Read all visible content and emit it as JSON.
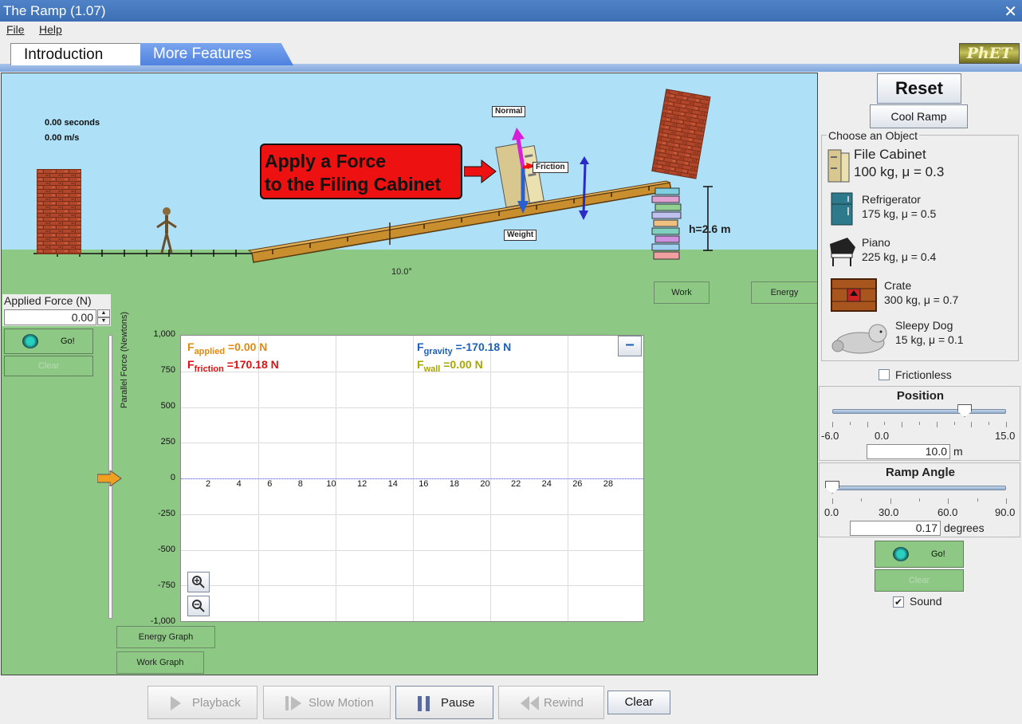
{
  "window": {
    "title": "The Ramp (1.07)",
    "close": "✕"
  },
  "menu": {
    "file": "File",
    "help": "Help"
  },
  "tabs": {
    "intro": "Introduction",
    "more": "More Features",
    "logo": "PhET"
  },
  "scene": {
    "time": "0.00 seconds",
    "speed": "0.00 m/s",
    "callout_line1": "Apply a Force",
    "callout_line2": "to the Filing Cabinet",
    "normal": "Normal",
    "friction": "Friction",
    "weight": "Weight",
    "height": "h=2.6 m",
    "angle": "10.0°",
    "work_btn": "Work",
    "energy_btn": "Energy"
  },
  "applied": {
    "label": "Applied Force (N)",
    "value": "0.00",
    "go": "Go!",
    "clear": "Clear"
  },
  "graph": {
    "ylabel": "Parallel Force (Newtons)",
    "yticks": [
      "1,000",
      "750",
      "500",
      "250",
      "0",
      "-250",
      "-500",
      "-750",
      "-1,000"
    ],
    "xticks": [
      "2",
      "4",
      "6",
      "8",
      "10",
      "12",
      "14",
      "16",
      "18",
      "20",
      "22",
      "24",
      "26",
      "28"
    ],
    "f_applied_main": "F",
    "f_applied_sub": "applied",
    "f_applied_val": " =0.00 N",
    "f_friction_main": "F",
    "f_friction_sub": "friction",
    "f_friction_val": " =170.18 N",
    "f_gravity_main": "F",
    "f_gravity_sub": "gravity",
    "f_gravity_val": " =-170.18 N",
    "f_wall_main": "F",
    "f_wall_sub": "wall",
    "f_wall_val": " =0.00 N",
    "minimize": "–",
    "energy_graph": "Energy Graph",
    "work_graph": "Work Graph"
  },
  "right": {
    "reset": "Reset",
    "cool_ramp": "Cool Ramp",
    "choose": "Choose an Object",
    "objects": [
      {
        "name": "File Cabinet",
        "props": "100 kg, μ = 0.3"
      },
      {
        "name": "Refrigerator",
        "props": "175 kg, μ = 0.5"
      },
      {
        "name": "Piano",
        "props": "225 kg, μ = 0.4"
      },
      {
        "name": "Crate",
        "props": "300 kg, μ = 0.7"
      },
      {
        "name": "Sleepy Dog",
        "props": "15 kg, μ = 0.1"
      }
    ],
    "frictionless": "Frictionless",
    "position": {
      "title": "Position",
      "min": "-6.0",
      "zero": "0.0",
      "max": "15.0",
      "value": "10.0",
      "unit": "m",
      "fraction": 0.762
    },
    "ramp_angle": {
      "title": "Ramp Angle",
      "t0": "0.0",
      "t1": "30.0",
      "t2": "60.0",
      "t3": "90.0",
      "value": "0.17",
      "unit": "degrees",
      "fraction": 0.0
    },
    "go": "Go!",
    "clear": "Clear",
    "sound": "Sound",
    "sound_checked": true
  },
  "playback": {
    "playback": "Playback",
    "slow_motion": "Slow Motion",
    "pause": "Pause",
    "rewind": "Rewind",
    "clear": "Clear"
  },
  "colors": {
    "sky": "#aee0f7",
    "grass": "#8ec885",
    "applied": "#e08a10",
    "friction": "#dd1111",
    "gravity": "#1b5fb8",
    "wall": "#a8a800"
  }
}
